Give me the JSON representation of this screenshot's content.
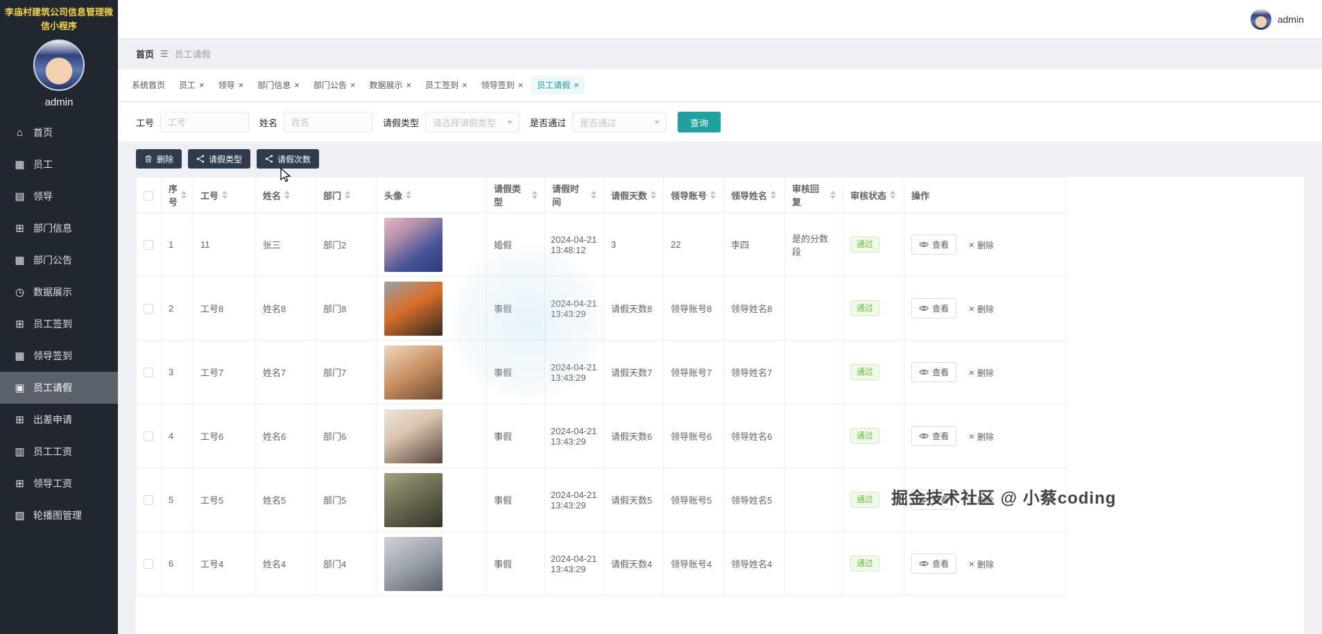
{
  "colors": {
    "accent_teal": "#1fa1a1",
    "sidebar_bg": "#20272e",
    "sidebar_title_yellow": "#f6d54a",
    "dark_button_bg": "#2e3c4e",
    "success_green": "#67c23a",
    "success_bg": "#f0f9eb",
    "page_bg": "#eef0f5"
  },
  "icons": {
    "close": "×",
    "hamburger": "☰"
  },
  "sidebar": {
    "app_title": "李庙村建筑公司信息管理微信小程序",
    "username": "admin",
    "items": [
      {
        "label": "首页",
        "icon": "home-icon",
        "glyph": "⌂",
        "active": false
      },
      {
        "label": "员工",
        "icon": "employees-icon",
        "glyph": "▦",
        "active": false
      },
      {
        "label": "领导",
        "icon": "leaders-chart-icon",
        "glyph": "▤",
        "active": false
      },
      {
        "label": "部门信息",
        "icon": "department-info-icon",
        "glyph": "⊞",
        "active": false
      },
      {
        "label": "部门公告",
        "icon": "department-notice-icon",
        "glyph": "▦",
        "active": false
      },
      {
        "label": "数据展示",
        "icon": "data-display-icon",
        "glyph": "◷",
        "active": false
      },
      {
        "label": "员工签到",
        "icon": "employee-checkin-icon",
        "glyph": "⊞",
        "active": false
      },
      {
        "label": "领导签到",
        "icon": "leader-checkin-icon",
        "glyph": "▦",
        "active": false
      },
      {
        "label": "员工请假",
        "icon": "employee-leave-icon",
        "glyph": "▣",
        "active": true
      },
      {
        "label": "出差申请",
        "icon": "business-trip-icon",
        "glyph": "⊞",
        "active": false
      },
      {
        "label": "员工工资",
        "icon": "employee-salary-icon",
        "glyph": "▥",
        "active": false
      },
      {
        "label": "领导工资",
        "icon": "leader-salary-icon",
        "glyph": "⊞",
        "active": false
      },
      {
        "label": "轮播图管理",
        "icon": "carousel-icon",
        "glyph": "▧",
        "active": false
      }
    ]
  },
  "header": {
    "username": "admin"
  },
  "breadcrumb": {
    "root": "首页",
    "current": "员工请假"
  },
  "tabs": [
    {
      "label": "系统首页",
      "closable": false,
      "active": false
    },
    {
      "label": "员工",
      "closable": true,
      "active": false
    },
    {
      "label": "领导",
      "closable": true,
      "active": false
    },
    {
      "label": "部门信息",
      "closable": true,
      "active": false
    },
    {
      "label": "部门公告",
      "closable": true,
      "active": false
    },
    {
      "label": "数据展示",
      "closable": true,
      "active": false
    },
    {
      "label": "员工签到",
      "closable": true,
      "active": false
    },
    {
      "label": "领导签到",
      "closable": true,
      "active": false
    },
    {
      "label": "员工请假",
      "closable": true,
      "active": true
    }
  ],
  "filters": {
    "job_no_label": "工号",
    "job_no_placeholder": "工号",
    "name_label": "姓名",
    "name_placeholder": "姓名",
    "leave_type_label": "请假类型",
    "leave_type_placeholder": "请选择请假类型",
    "approved_label": "是否通过",
    "approved_placeholder": "是否通过",
    "search_label": "查询"
  },
  "actions": {
    "delete_label": "删除",
    "leave_type_label": "请假类型",
    "leave_count_label": "请假次数"
  },
  "table": {
    "columns": [
      {
        "label": "序号",
        "sortable": true
      },
      {
        "label": "工号",
        "sortable": true
      },
      {
        "label": "姓名",
        "sortable": true
      },
      {
        "label": "部门",
        "sortable": true
      },
      {
        "label": "头像",
        "sortable": true
      },
      {
        "label": "请假类型",
        "sortable": true
      },
      {
        "label": "请假时间",
        "sortable": true
      },
      {
        "label": "请假天数",
        "sortable": true
      },
      {
        "label": "领导账号",
        "sortable": true
      },
      {
        "label": "领导姓名",
        "sortable": true
      },
      {
        "label": "审核回复",
        "sortable": true
      },
      {
        "label": "审核状态",
        "sortable": true
      },
      {
        "label": "操作",
        "sortable": false
      }
    ],
    "view_label": "查看",
    "row_delete_label": "删除",
    "rows": [
      {
        "index": "1",
        "job_no": "11",
        "name": "张三",
        "dept": "部门2",
        "leave_type": "婚假",
        "time": "2024-04-21 13:48:12",
        "days": "3",
        "leader_account": "22",
        "leader_name": "李四",
        "reply": "是的分数段",
        "status": "通过",
        "avatar_bg": "linear-gradient(145deg,#e3b7c9 0%,#b68fa8 30%,#46549a 65%,#2e3c74 100%)"
      },
      {
        "index": "2",
        "job_no": "工号8",
        "name": "姓名8",
        "dept": "部门8",
        "leave_type": "事假",
        "time": "2024-04-21 13:43:29",
        "days": "请假天数8",
        "leader_account": "领导账号8",
        "leader_name": "领导姓名8",
        "reply": "",
        "status": "通过",
        "avatar_bg": "linear-gradient(150deg,#9aa0a6 0%,#d86f2a 45%,#30281f 100%)"
      },
      {
        "index": "3",
        "job_no": "工号7",
        "name": "姓名7",
        "dept": "部门7",
        "leave_type": "事假",
        "time": "2024-04-21 13:43:29",
        "days": "请假天数7",
        "leader_account": "领导账号7",
        "leader_name": "领导姓名7",
        "reply": "",
        "status": "通过",
        "avatar_bg": "linear-gradient(150deg,#f0d9c0 0%,#c98f62 50%,#6b4a2e 100%)"
      },
      {
        "index": "4",
        "job_no": "工号6",
        "name": "姓名6",
        "dept": "部门6",
        "leave_type": "事假",
        "time": "2024-04-21 13:43:29",
        "days": "请假天数6",
        "leader_account": "领导账号6",
        "leader_name": "领导姓名6",
        "reply": "",
        "status": "通过",
        "avatar_bg": "linear-gradient(150deg,#efe6dc 0%,#d9c4ae 40%,#57433a 100%)"
      },
      {
        "index": "5",
        "job_no": "工号5",
        "name": "姓名5",
        "dept": "部门5",
        "leave_type": "事假",
        "time": "2024-04-21 13:43:29",
        "days": "请假天数5",
        "leader_account": "领导账号5",
        "leader_name": "领导姓名5",
        "reply": "",
        "status": "通过",
        "avatar_bg": "linear-gradient(150deg,#a3a182 0%,#6f6d52 45%,#33322a 100%)"
      },
      {
        "index": "6",
        "job_no": "工号4",
        "name": "姓名4",
        "dept": "部门4",
        "leave_type": "事假",
        "time": "2024-04-21 13:43:29",
        "days": "请假天数4",
        "leader_account": "领导账号4",
        "leader_name": "领导姓名4",
        "reply": "",
        "status": "通过",
        "avatar_bg": "linear-gradient(150deg,#cfd4d8 0%,#9aa1a8 50%,#5a616a 100%)"
      }
    ]
  },
  "watermark": "掘金技术社区 @ 小蔡coding"
}
